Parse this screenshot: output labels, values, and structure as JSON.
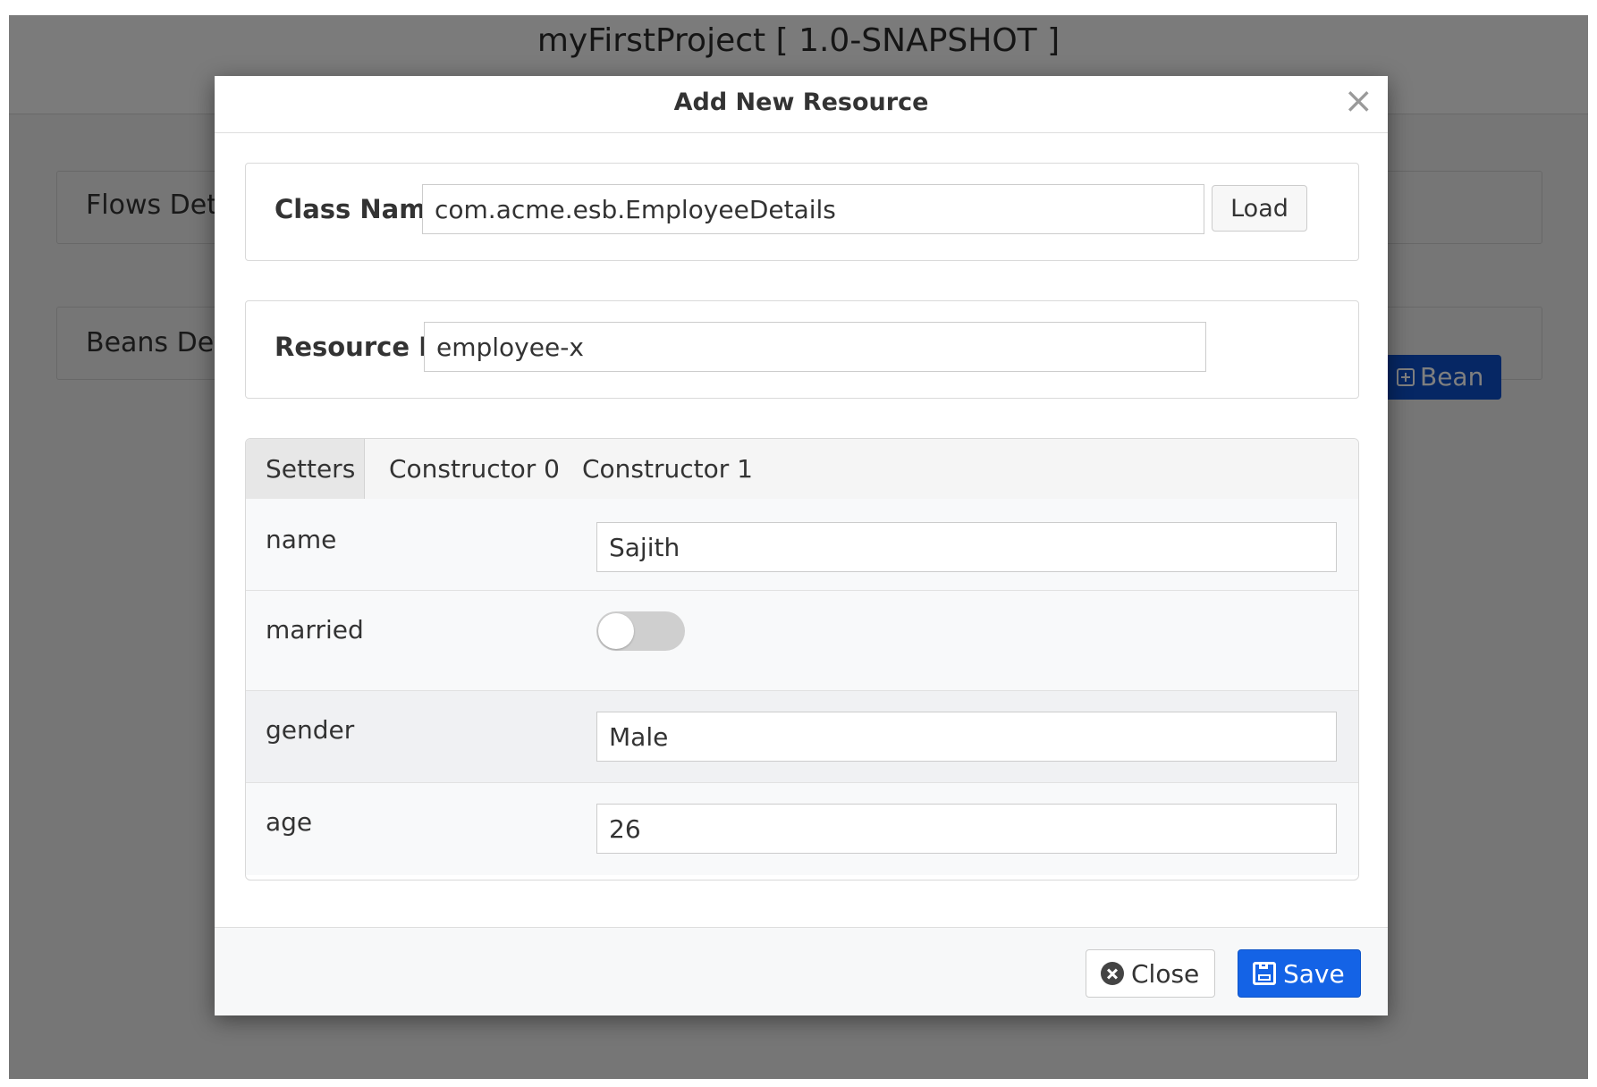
{
  "background": {
    "app_title": "myFirstProject [ 1.0-SNAPSHOT ]",
    "flows_panel_label": "Flows Det",
    "beans_panel_label": "Beans Deta",
    "add_bean_label": "Bean"
  },
  "modal": {
    "title": "Add New Resource",
    "close_glyph": "×",
    "class_name": {
      "label": "Class Name:",
      "value": "com.acme.esb.EmployeeDetails",
      "load_label": "Load"
    },
    "resource_id": {
      "label": "Resource ID:",
      "value": "employee-x"
    },
    "tabs": [
      {
        "label": "Setters",
        "active": true
      },
      {
        "label": "Constructor 0",
        "active": false
      },
      {
        "label": "Constructor 1",
        "active": false
      }
    ],
    "setters": {
      "name": {
        "label": "name",
        "value": "Sajith"
      },
      "married": {
        "label": "married",
        "value": false
      },
      "gender": {
        "label": "gender",
        "value": "Male"
      },
      "age": {
        "label": "age",
        "value": "26"
      }
    },
    "footer": {
      "close_label": "Close",
      "save_label": "Save"
    }
  },
  "colors": {
    "primary": "#1463e6",
    "background_primary": "#0d4fc8",
    "toggle_off": "#cfcfcf"
  },
  "icons": [
    "add-square-icon",
    "close-x-icon",
    "close-circle-icon",
    "save-icon"
  ]
}
